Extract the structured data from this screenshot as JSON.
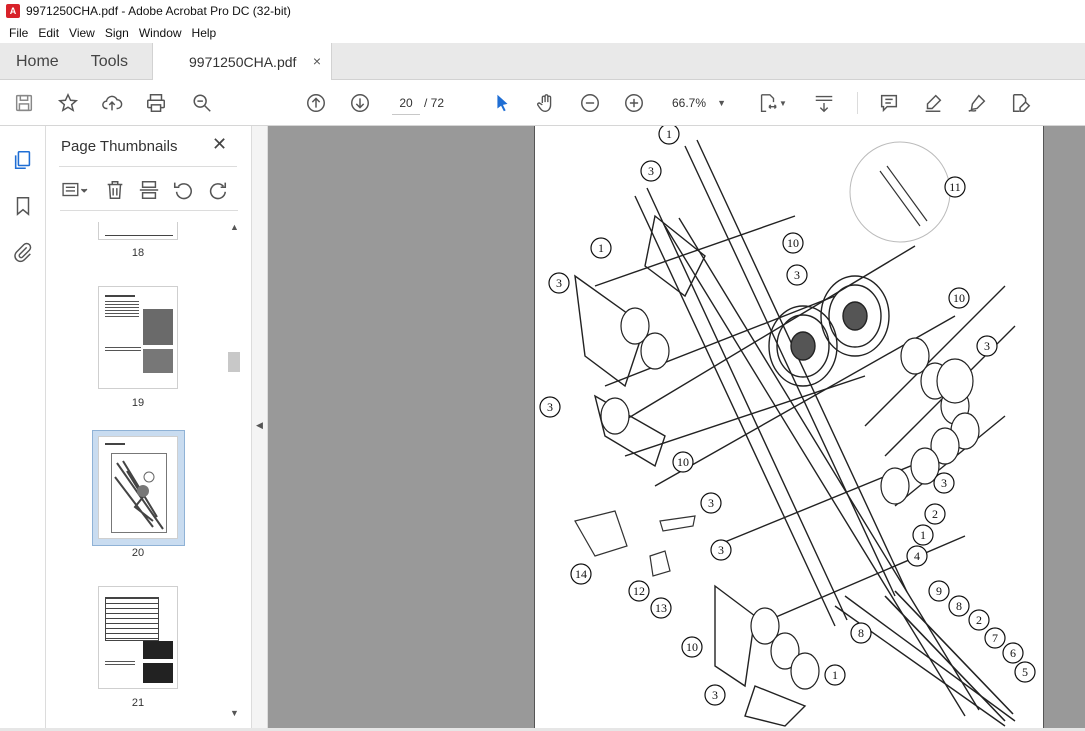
{
  "window": {
    "title": "9971250CHA.pdf - Adobe Acrobat Pro DC (32-bit)"
  },
  "menu": [
    "File",
    "Edit",
    "View",
    "Sign",
    "Window",
    "Help"
  ],
  "tabs": {
    "home": "Home",
    "tools": "Tools",
    "document": "9971250CHA.pdf",
    "close": "×"
  },
  "toolbar": {
    "page_current": "20",
    "page_total": "/ 72",
    "zoom": "66.7%"
  },
  "panel": {
    "title": "Page Thumbnails",
    "close": "✕",
    "thumbnails": [
      {
        "label": "18"
      },
      {
        "label": "19"
      },
      {
        "label": "20",
        "selected": true
      },
      {
        "label": "21"
      }
    ]
  },
  "diagram": {
    "callouts": [
      "1",
      "3",
      "1",
      "10",
      "3",
      "3",
      "11",
      "10",
      "3",
      "3",
      "10",
      "3",
      "3",
      "2",
      "1",
      "4",
      "14",
      "3",
      "12",
      "13",
      "9",
      "8",
      "2",
      "7",
      "6",
      "5",
      "8",
      "10",
      "1",
      "3"
    ]
  }
}
